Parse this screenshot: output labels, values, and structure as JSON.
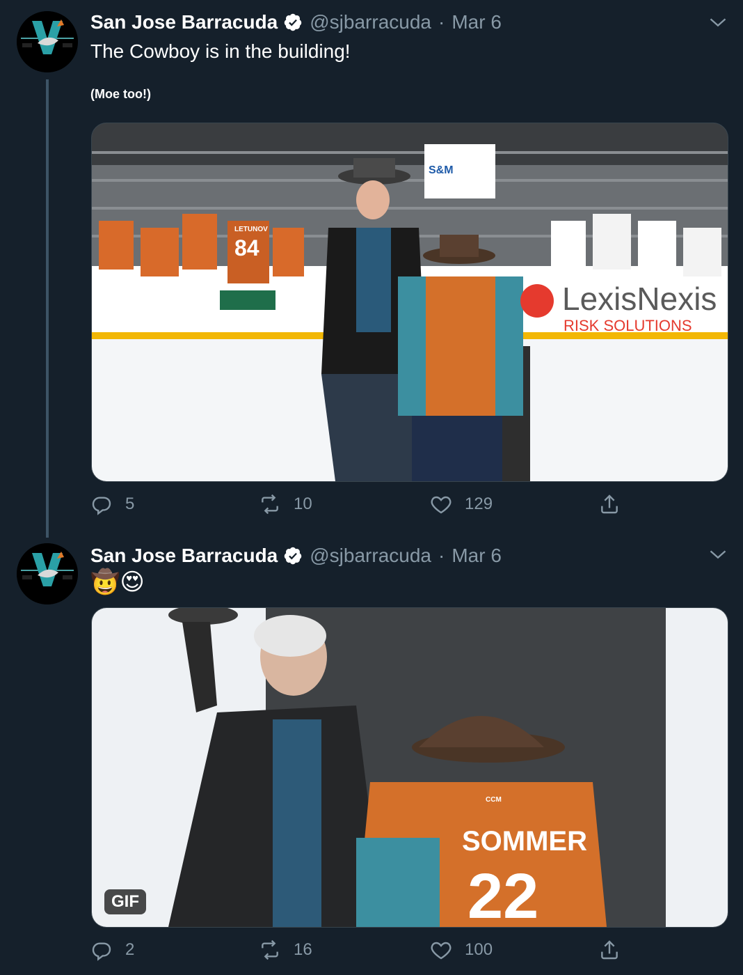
{
  "tweets": [
    {
      "author_name": "San Jose Barracuda",
      "handle": "@sjbarracuda",
      "separator": "·",
      "date": "Mar 6",
      "text": "The Cowboy is in the building!",
      "subtext": "(Moe too!)",
      "replies": "5",
      "retweets": "10",
      "likes": "129",
      "media_text": {
        "ad_brand_1": "LexisNexis",
        "ad_brand_2": "RISK SOLUTIONS",
        "board_text": "S&M",
        "jersey_player": "LETUNOV",
        "jersey_number": "84"
      }
    },
    {
      "author_name": "San Jose Barracuda",
      "handle": "@sjbarracuda",
      "separator": "·",
      "date": "Mar 6",
      "emoji": "🤠😍",
      "gif_label": "GIF",
      "replies": "2",
      "retweets": "16",
      "likes": "100",
      "media_text": {
        "jersey_name": "SOMMER",
        "jersey_number": "22",
        "brand": "CCM"
      }
    }
  ],
  "colors": {
    "background": "#15202b",
    "secondary_text": "#8899a6",
    "verified": "#ffffff",
    "border": "#38444d"
  }
}
